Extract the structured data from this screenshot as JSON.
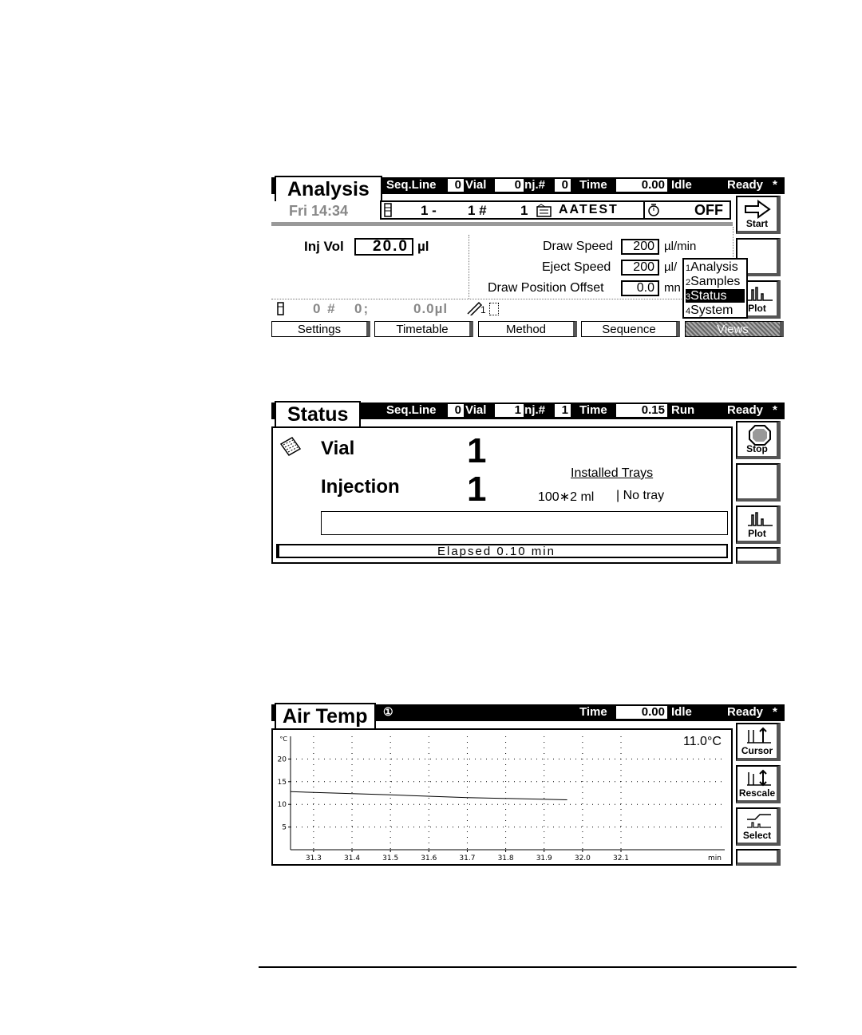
{
  "analysis": {
    "title": "Analysis",
    "header": {
      "seq_line_label": "Seq.Line",
      "seq_line": "0",
      "vial_label": "Vial",
      "vial": "0",
      "inj_label": "Inj.#",
      "inj": "0",
      "time_label": "Time",
      "time": "0.00",
      "state": "Idle",
      "ready": "Ready",
      "star": "*"
    },
    "date_time": "Fri 14:34",
    "seq_from": "1 -",
    "seq_to": "1 #",
    "seq_num": "1",
    "method_name": "AATEST",
    "timer_state": "OFF",
    "inj_vol_label": "Inj Vol",
    "inj_vol": "20.0",
    "inj_vol_unit": "µl",
    "draw_speed_label": "Draw Speed",
    "draw_speed": "200",
    "draw_speed_unit": "µl/min",
    "eject_speed_label": "Eject Speed",
    "eject_speed": "200",
    "eject_speed_unit": "µl/",
    "draw_offset_label": "Draw Position Offset",
    "draw_offset": "0.0",
    "draw_offset_unit": "mn",
    "status_vial": "0 #",
    "status_inj": "0;",
    "status_vol": "0.0µl",
    "status_needle": "1",
    "side": {
      "start": "Start",
      "plot": "Plot"
    },
    "tabs": [
      "Settings",
      "Timetable",
      "Method",
      "Sequence",
      "Views"
    ],
    "views_menu": [
      {
        "num": "1",
        "label": "Analysis"
      },
      {
        "num": "2",
        "label": "Samples"
      },
      {
        "num": "3",
        "label": "Status"
      },
      {
        "num": "4",
        "label": "System"
      }
    ]
  },
  "status": {
    "title": "Status",
    "header": {
      "seq_line_label": "Seq.Line",
      "seq_line": "0",
      "vial_label": "Vial",
      "vial": "1",
      "inj_label": "Inj.#",
      "inj": "1",
      "time_label": "Time",
      "time": "0.15",
      "state": "Run",
      "ready": "Ready",
      "star": "*"
    },
    "vial_label": "Vial",
    "vial_value": "1",
    "injection_label": "Injection",
    "injection_value": "1",
    "installed_trays_label": "Installed Trays",
    "tray1": "100∗2 ml",
    "tray2": "| No tray",
    "elapsed": "Elapsed 0.10 min",
    "side": {
      "stop": "Stop",
      "plot": "Plot"
    }
  },
  "airtemp": {
    "title": "Air Temp",
    "circle_num": "①",
    "header": {
      "time_label": "Time",
      "time": "0.00",
      "state": "Idle",
      "ready": "Ready",
      "star": "*"
    },
    "current_reading": "11.0°C",
    "side": {
      "cursor": "Cursor",
      "rescale": "Rescale",
      "select": "Select"
    },
    "chart_data": {
      "type": "line",
      "ylabel": "°C",
      "xlabel": "min",
      "x_ticks": [
        31.3,
        31.4,
        31.5,
        31.6,
        31.7,
        31.8,
        31.9,
        32.0,
        32.1
      ],
      "x_tick_labels": [
        "31.3",
        "31.4",
        "31.5",
        "31.6",
        "31.7",
        "31.8",
        "31.9",
        "32.0",
        "32.1"
      ],
      "y_ticks": [
        5,
        10,
        15,
        20
      ],
      "xlim": [
        31.24,
        32.37
      ],
      "ylim": [
        0,
        25
      ],
      "grid": true,
      "series": [
        {
          "x": [
            31.24,
            31.5,
            31.7,
            31.96
          ],
          "y": [
            12.8,
            12.1,
            11.5,
            11.0
          ]
        }
      ]
    }
  }
}
